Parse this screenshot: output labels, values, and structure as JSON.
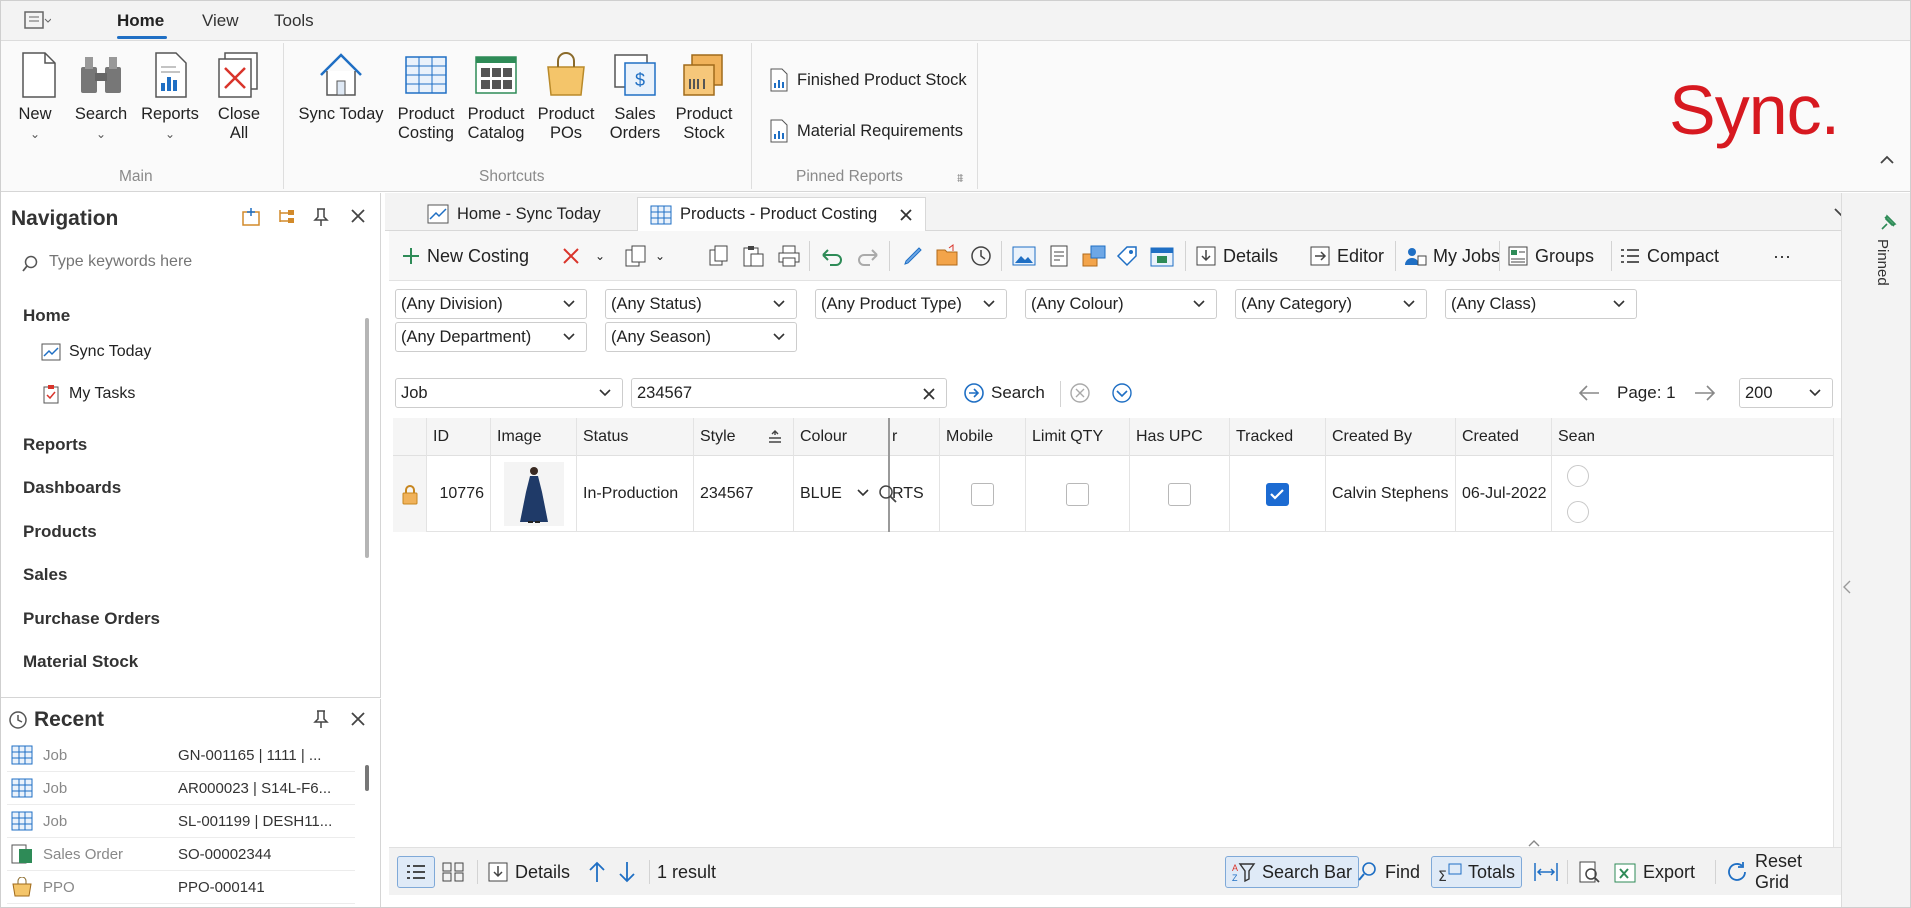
{
  "menu": {
    "tabs": [
      "Home",
      "View",
      "Tools"
    ]
  },
  "ribbon": {
    "main": {
      "label": "Main",
      "buttons": [
        "New",
        "Search",
        "Reports",
        "Close",
        "All"
      ]
    },
    "shortcuts": {
      "label": "Shortcuts",
      "buttons": [
        {
          "l1": "Sync Today",
          "l2": ""
        },
        {
          "l1": "Product",
          "l2": "Costing"
        },
        {
          "l1": "Product",
          "l2": "Catalog"
        },
        {
          "l1": "Product",
          "l2": "POs"
        },
        {
          "l1": "Sales",
          "l2": "Orders"
        },
        {
          "l1": "Product",
          "l2": "Stock"
        }
      ]
    },
    "pinned_reports": {
      "label": "Pinned Reports",
      "items": [
        "Finished Product Stock",
        "Material Requirements"
      ]
    },
    "brand": "Sync."
  },
  "navigation": {
    "title": "Navigation",
    "search_placeholder": "Type keywords here",
    "home": "Home",
    "home_items": [
      "Sync Today",
      "My Tasks"
    ],
    "sections": [
      "Reports",
      "Dashboards",
      "Products",
      "Sales",
      "Purchase Orders",
      "Material Stock"
    ]
  },
  "recent": {
    "title": "Recent",
    "rows": [
      {
        "type": "Job",
        "value": "GN-001165 | 1111 | ..."
      },
      {
        "type": "Job",
        "value": "AR000023 | S14L-F6..."
      },
      {
        "type": "Job",
        "value": "SL-001199 | DESH11..."
      },
      {
        "type": "Sales Order",
        "value": "SO-00002344"
      },
      {
        "type": "PPO",
        "value": "PPO-000141"
      }
    ]
  },
  "doc_tabs": [
    "Home - Sync Today",
    "Products - Product Costing"
  ],
  "toolbar": {
    "new_costing": "New Costing",
    "details": "Details",
    "editor": "Editor",
    "my_jobs": "My Jobs",
    "groups": "Groups",
    "compact": "Compact",
    "more": "···"
  },
  "filters": [
    "(Any Division)",
    "(Any Status)",
    "(Any Product Type)",
    "(Any Colour)",
    "(Any Category)",
    "(Any Class)",
    "(Any Department)",
    "(Any Season)"
  ],
  "search": {
    "field": "Job",
    "value": "234567",
    "button": "Search",
    "page_label": "Page: 1",
    "page_size": "200"
  },
  "grid": {
    "columns": [
      "ID",
      "Image",
      "Status",
      "Style",
      "Colour",
      "r",
      "Mobile",
      "Limit QTY",
      "Has UPC",
      "Tracked",
      "Created By",
      "Created",
      "Seam"
    ],
    "row": {
      "id": "10776",
      "status": "In-Production",
      "style": "234567",
      "colour": "BLUE",
      "r": "RTS",
      "mobile": false,
      "limit_qty": false,
      "has_upc": false,
      "tracked": true,
      "created_by": "Calvin Stephens",
      "created": "06-Jul-2022"
    }
  },
  "statusbar": {
    "details": "Details",
    "results": "1 result",
    "search_bar": "Search Bar",
    "find": "Find",
    "totals": "Totals",
    "export": "Export",
    "reset_grid": "Reset Grid"
  },
  "side_strip": {
    "label": "Pinned"
  },
  "colors": {
    "accent": "#1f6fc4",
    "brand": "#d71920",
    "checkbox_on": "#1c6bd2"
  }
}
